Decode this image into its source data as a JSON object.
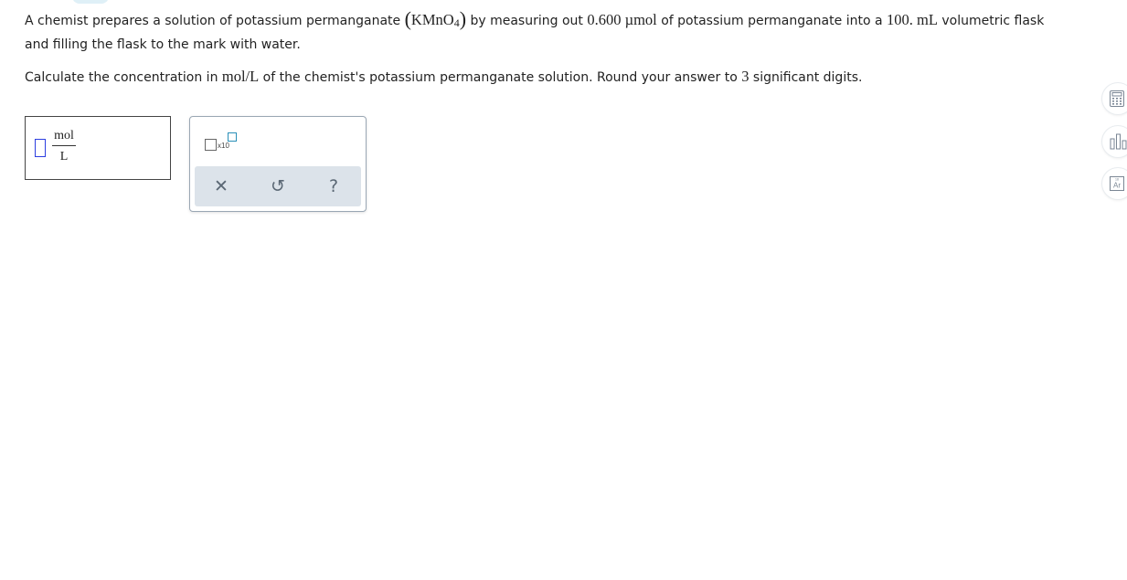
{
  "question": {
    "line1": {
      "t1": "A chemist prepares a solution of potassium permanganate ",
      "paren_open": "(",
      "formula_main": "KMnO",
      "formula_sub": "4",
      "paren_close": ")",
      "t2": " by measuring out ",
      "amount": "0.600 µmol",
      "t3": " of potassium permanganate into a ",
      "volume": "100. mL",
      "t4": " volumetric flask and filling the flask to the mark with water."
    },
    "line2": {
      "t1": "Calculate the concentration in ",
      "unit": "mol/L",
      "t2": " of the chemist's potassium permanganate solution. Round your answer to ",
      "sig": "3",
      "t3": " significant digits."
    }
  },
  "answer": {
    "value": "",
    "numerator_unit": "mol",
    "denominator_unit": "L"
  },
  "toolbox": {
    "sci_label": "x10",
    "clear_glyph": "✕",
    "undo_glyph": "↺",
    "help_glyph": "?"
  },
  "side_tools": {
    "periodic_label": "Ar"
  },
  "colors": {
    "input_border": "#2c3ee0",
    "exponent_box": "#2a8fb8",
    "action_bar": "#dce3ea",
    "tab_highlight": "#dff0f7"
  }
}
